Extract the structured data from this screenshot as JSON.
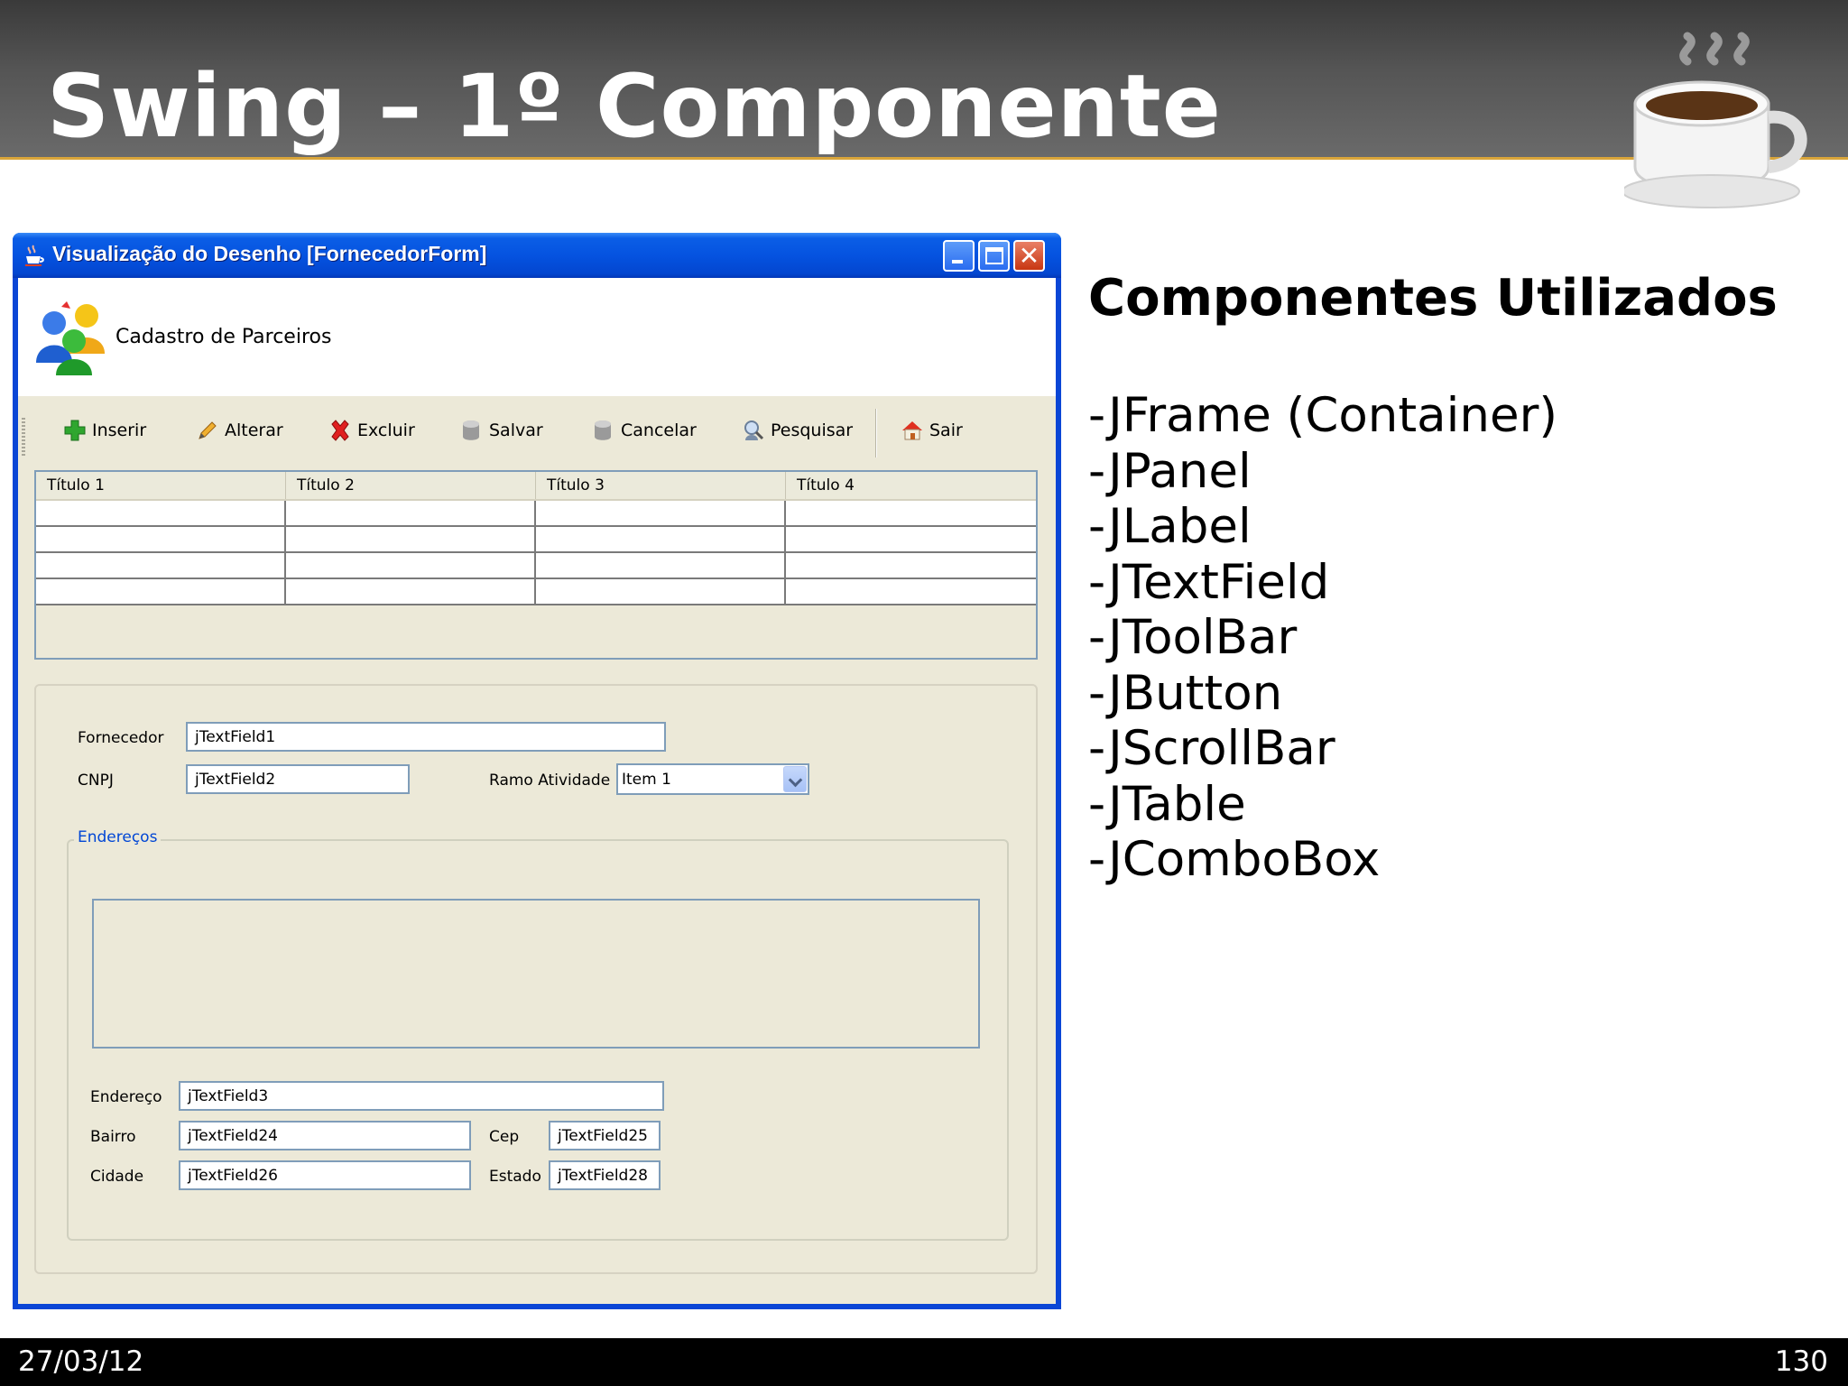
{
  "slide": {
    "title": "Swing – 1º Componente",
    "date": "27/03/12",
    "page": "130"
  },
  "components": {
    "heading": "Componentes Utilizados",
    "items": [
      "-JFrame (Container)",
      "-JPanel",
      "-JLabel",
      "-JTextField",
      "-JToolBar",
      "-JButton",
      "-JScrollBar",
      "-JTable",
      "-JComboBox"
    ]
  },
  "window": {
    "title": "Visualização do Desenho [FornecedorForm]",
    "banner_title": "Cadastro de Parceiros",
    "toolbar": {
      "inserir": "Inserir",
      "alterar": "Alterar",
      "excluir": "Excluir",
      "salvar": "Salvar",
      "cancelar": "Cancelar",
      "pesquisar": "Pesquisar",
      "sair": "Sair"
    },
    "table": {
      "headers": [
        "Título 1",
        "Título 2",
        "Título 3",
        "Título 4"
      ]
    },
    "form": {
      "fornecedor_label": "Fornecedor",
      "fornecedor_value": "jTextField1",
      "cnpj_label": "CNPJ",
      "cnpj_value": "jTextField2",
      "ramo_label": "Ramo Atividade",
      "ramo_value": "Item 1",
      "enderecos_legend": "Endereços",
      "endereco_label": "Endereço",
      "endereco_value": "jTextField3",
      "bairro_label": "Bairro",
      "bairro_value": "jTextField24",
      "cep_label": "Cep",
      "cep_value": "jTextField25",
      "cidade_label": "Cidade",
      "cidade_value": "jTextField26",
      "estado_label": "Estado",
      "estado_value": "jTextField28"
    }
  },
  "colors": {
    "title_bar_blue": "#0553e0",
    "window_bg": "#ece9d8",
    "field_border": "#7f9db9",
    "legend_blue": "#0046d5",
    "header_dark": "#4a4a4a",
    "accent_gold": "#d9a53a"
  }
}
